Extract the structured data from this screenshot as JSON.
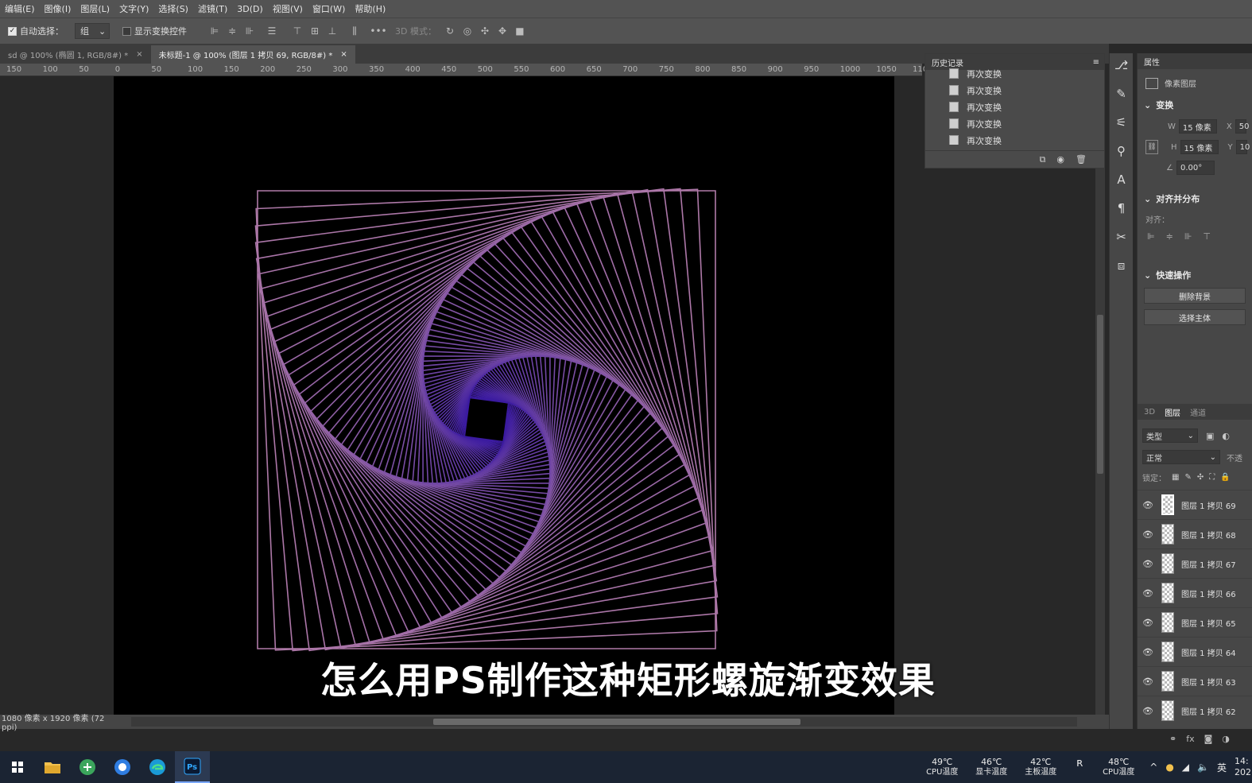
{
  "menu": [
    "编辑(E)",
    "图像(I)",
    "图层(L)",
    "文字(Y)",
    "选择(S)",
    "滤镜(T)",
    "3D(D)",
    "视图(V)",
    "窗口(W)",
    "帮助(H)"
  ],
  "options": {
    "auto_select_label": "自动选择：",
    "auto_select_value": "组",
    "show_transform_label": "显示变换控件",
    "mode_3d_label": "3D 模式："
  },
  "tabs": [
    {
      "label": "sd @ 100% (椭圆 1, RGB/8#) *",
      "active": false
    },
    {
      "label": "未标题-1 @ 100% (图层 1 拷贝 69, RGB/8#) *",
      "active": true
    }
  ],
  "ruler": [
    "150",
    "100",
    "50",
    "0",
    "50",
    "100",
    "150",
    "200",
    "250",
    "300",
    "350",
    "400",
    "450",
    "500",
    "550",
    "600",
    "650",
    "700",
    "750",
    "800",
    "850",
    "900",
    "950",
    "1000",
    "1050",
    "1100"
  ],
  "subtitle": "怎么用PS制作这种矩形螺旋渐变效果",
  "status": "1080 像素 x 1920 像素 (72 ppi)",
  "history": {
    "title": "历史记录",
    "items": [
      "再次变换",
      "再次变换",
      "再次变换",
      "再次变换",
      "再次变换"
    ]
  },
  "properties": {
    "tab": "属性",
    "layer_type": "像素图层",
    "transform_title": "变换",
    "w_label": "W",
    "w_value": "15 像素",
    "x_label": "X",
    "x_value": "50",
    "h_label": "H",
    "h_value": "15 像素",
    "y_label": "Y",
    "y_value": "10",
    "angle_value": "0.00°",
    "align_title": "对齐并分布",
    "align_label": "对齐：",
    "quick_title": "快速操作",
    "remove_bg": "删除背景",
    "select_subject": "选择主体"
  },
  "layers_panel": {
    "tabs": [
      "3D",
      "图层",
      "通道"
    ],
    "filter": "类型",
    "blend": "正常",
    "opacity_label": "不透",
    "lock_label": "锁定：",
    "layers": [
      {
        "name": "图层 1 拷贝 69",
        "selected": true
      },
      {
        "name": "图层 1 拷贝 68",
        "selected": false
      },
      {
        "name": "图层 1 拷贝 67",
        "selected": false
      },
      {
        "name": "图层 1 拷贝 66",
        "selected": false
      },
      {
        "name": "图层 1 拷贝 65",
        "selected": false
      },
      {
        "name": "图层 1 拷贝 64",
        "selected": false
      },
      {
        "name": "图层 1 拷贝 63",
        "selected": false
      },
      {
        "name": "图层 1 拷贝 62",
        "selected": false
      }
    ]
  },
  "taskbar": {
    "temps": [
      {
        "value": "49℃",
        "label": "CPU温度"
      },
      {
        "value": "46℃",
        "label": "显卡温度"
      },
      {
        "value": "42℃",
        "label": "主板温度"
      },
      {
        "value": "48℃",
        "label": "CPU温度"
      }
    ],
    "ime": "英",
    "clock": "14:",
    "clock2": "202"
  },
  "spiral": {
    "count": 70,
    "rotation_step_deg": 2.5,
    "scale_step": 0.965,
    "color_start": "#b07aa8",
    "color_end": "#3a1aa0"
  }
}
